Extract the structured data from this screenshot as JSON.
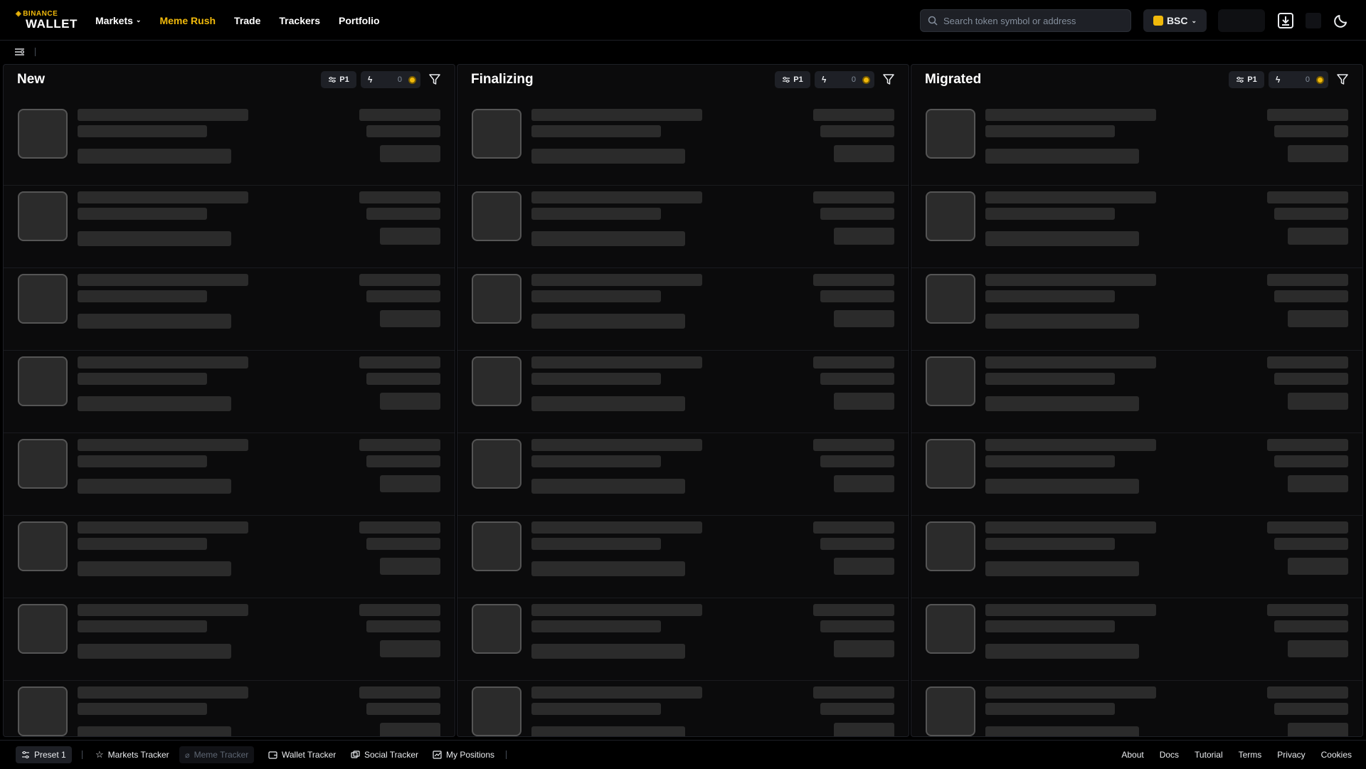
{
  "brand": {
    "line1": "BINANCE",
    "line2": "WALLET"
  },
  "nav": [
    {
      "label": "Markets",
      "has_caret": true
    },
    {
      "label": "Meme Rush",
      "active": true
    },
    {
      "label": "Trade"
    },
    {
      "label": "Trackers"
    },
    {
      "label": "Portfolio"
    }
  ],
  "search": {
    "placeholder": "Search token symbol or address"
  },
  "chain": {
    "label": "BSC"
  },
  "columns": [
    {
      "title": "New",
      "preset": "P1",
      "quick_buy_amount": "0"
    },
    {
      "title": "Finalizing",
      "preset": "P1",
      "quick_buy_amount": "0"
    },
    {
      "title": "Migrated",
      "preset": "P1",
      "quick_buy_amount": "0"
    }
  ],
  "footer": {
    "tabs": [
      {
        "label": "Preset 1",
        "icon": "sliders-icon"
      },
      {
        "label": "Markets Tracker",
        "icon": "star-icon"
      },
      {
        "label": "Meme Tracker",
        "icon": "pill-icon"
      },
      {
        "label": "Wallet Tracker",
        "icon": "wallet-icon"
      },
      {
        "label": "Social Tracker",
        "icon": "social-icon"
      },
      {
        "label": "My Positions",
        "icon": "chart-icon"
      }
    ],
    "links": [
      "About",
      "Docs",
      "Tutorial",
      "Terms",
      "Privacy",
      "Cookies"
    ]
  },
  "colors": {
    "accent": "#f0b90b",
    "background": "#000000",
    "skeleton": "#2b2b2b"
  }
}
